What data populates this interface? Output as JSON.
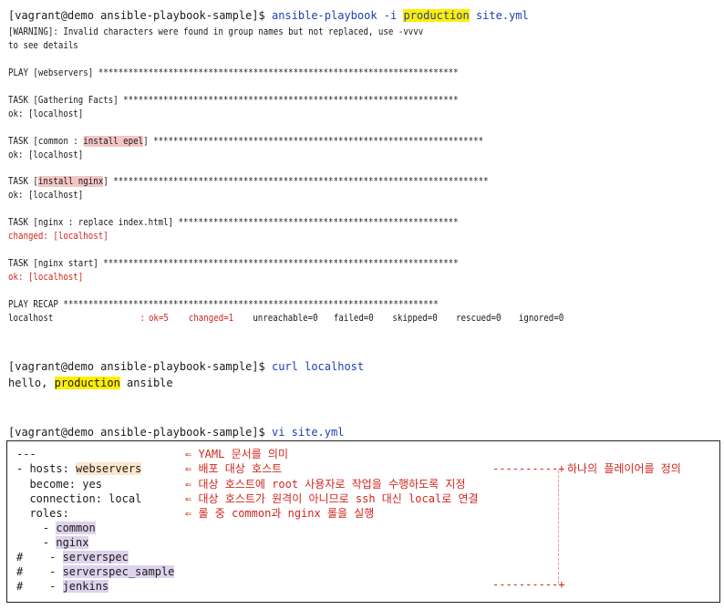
{
  "prompt1": "[vagrant@demo ansible-playbook-sample]$ ",
  "cmd1_a": "ansible-playbook -i ",
  "cmd1_hl": "production",
  "cmd1_b": " site.yml",
  "warning_1": "[WARNING]: Invalid characters were found in group names but not replaced, use -vvvv",
  "warning_2": "to see details",
  "play_header": "PLAY [webservers] ************************************************************************",
  "task1": "TASK [Gathering Facts] *******************************************************************",
  "task1_result": "ok: [localhost]",
  "task2_pre": "TASK [common : ",
  "task2_hl": "install epel",
  "task2_post": "] ******************************************************************",
  "task2_result": "ok: [localhost]",
  "task3_pre": "TASK [",
  "task3_hl": "install nginx",
  "task3_post": "] ***************************************************************************",
  "task3_result": "ok: [localhost]",
  "task4": "TASK [nginx : replace index.html] ********************************************************",
  "task4_result": "changed: [localhost]",
  "task5": "TASK [nginx start] ***********************************************************************",
  "task5_result": "ok: [localhost]",
  "recap_header": "PLAY RECAP ***************************************************************************",
  "recap": {
    "host": "localhost",
    "colon": ":",
    "ok": "ok=5",
    "changed": "changed=1",
    "unreachable": "unreachable=0",
    "failed": "failed=0",
    "skipped": "skipped=0",
    "rescued": "rescued=0",
    "ignored": "ignored=0"
  },
  "prompt2": "[vagrant@demo ansible-playbook-sample]$ ",
  "cmd2": "curl localhost",
  "curl_pre": "hello, ",
  "curl_hl": "production",
  "curl_post": " ansible",
  "prompt3": "[vagrant@demo ansible-playbook-sample]$ ",
  "cmd3": "vi site.yml",
  "yaml": {
    "l1": "---",
    "l2_pre": "- hosts: ",
    "l2_hl": "webservers",
    "l3": "  become: yes",
    "l4": "  connection: local",
    "l5": "  roles:",
    "l6_pre": "    - ",
    "l6_hl": "common",
    "l7_pre": "    - ",
    "l7_hl": "nginx",
    "l8_pre": "#    - ",
    "l8_hl": "serverspec",
    "l9_pre": "#    - ",
    "l9_hl": "serverspec_sample",
    "l10_pre": "#    - ",
    "l10_hl": "jenkins"
  },
  "annotations": {
    "a1": "⇐ YAML 문서를 의미",
    "a2": "⇐ 배포 대상 호스트",
    "a3": "⇐ 대상 호스트에 root 사용자로 작업을 수행하도록 지정",
    "a4": "⇐ 대상 호스트가 원격이 아니므로 ssh 대신 local로 연결",
    "a5": "⇐ 롤 중 common과 nginx 롤을 실행",
    "bracket_top": "----------+",
    "bracket_bottom": "----------+",
    "side_note": "하나의 플레이어를 정의"
  },
  "colors": {
    "command": "#1d3fb3",
    "error_red": "#d0261c",
    "highlight_yellow": "#ffee00",
    "highlight_pink": "#f3c6c6",
    "highlight_orange": "#fde7cc",
    "highlight_violet": "#ddd3ec"
  }
}
